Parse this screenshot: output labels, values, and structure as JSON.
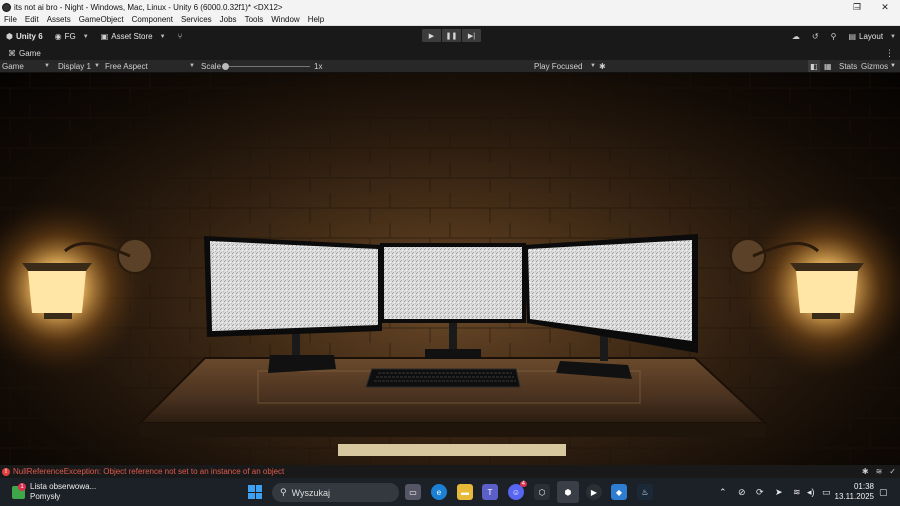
{
  "window": {
    "title": "its not ai bro - Night - Windows, Mac, Linux - Unity 6 (6000.0.32f1)* <DX12>",
    "controls": {
      "minimize": "–",
      "maximize": "❐",
      "close": "✕"
    }
  },
  "menu": [
    "File",
    "Edit",
    "Assets",
    "GameObject",
    "Component",
    "Services",
    "Jobs",
    "Tools",
    "Window",
    "Help"
  ],
  "toolbar": {
    "unity_label": "Unity 6",
    "account_label": "FG",
    "asset_store_label": "Asset Store",
    "layout_label": "Layout"
  },
  "tab": {
    "label": "Game"
  },
  "gamebar": {
    "view_mode": "Game",
    "display": "Display 1",
    "aspect": "Free Aspect",
    "scale_label": "Scale",
    "scale_value": "1x",
    "scale_fraction": 0.0,
    "play_mode": "Play Focused",
    "stats_label": "Stats",
    "gizmos_label": "Gizmos"
  },
  "console": {
    "error_message": "NullReferenceException: Object reference not set to an instance of an object"
  },
  "taskbar": {
    "widget_title": "Lista obserwowa...",
    "widget_subtitle": "Pomysły",
    "widget_badge": "1",
    "search_placeholder": "Wyszukaj",
    "discord_badge": "4",
    "time": "01:38",
    "date": "13.11.2025"
  },
  "colors": {
    "unity_toolbar": "#191919",
    "gamebar": "#282828",
    "error_text": "#e05a4f",
    "taskbar": "#1c2027",
    "windows_accent": "#3ea0f0"
  }
}
